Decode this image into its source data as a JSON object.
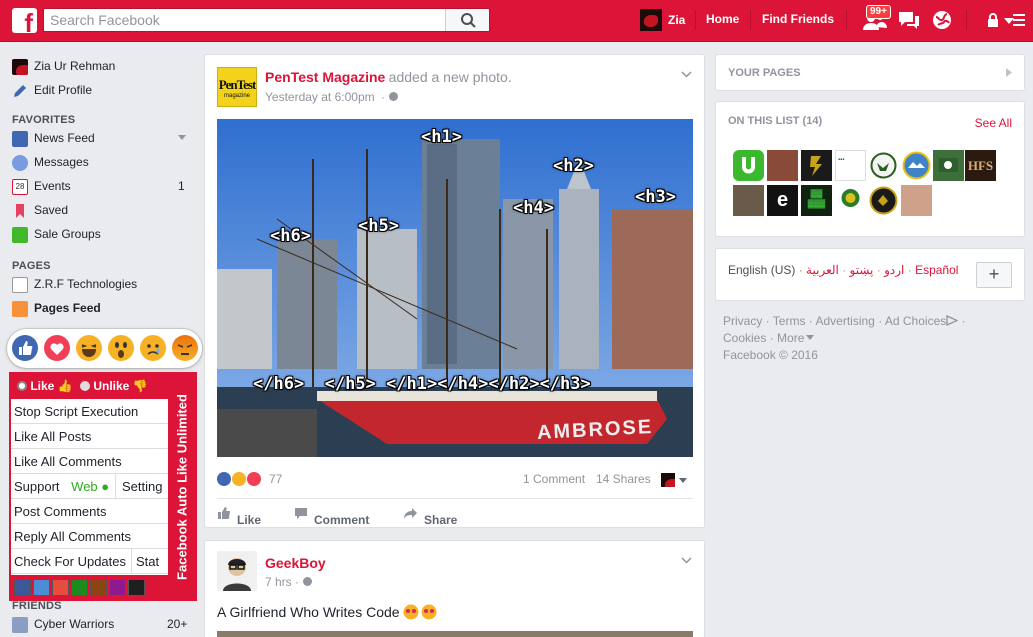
{
  "topbar": {
    "search_placeholder": "Search Facebook",
    "user_name": "Zia",
    "home_label": "Home",
    "find_friends_label": "Find Friends",
    "friend_requests_badge": "99+"
  },
  "left": {
    "profile_name": "Zia Ur Rehman",
    "edit_profile": "Edit Profile",
    "favorites_header": "FAVORITES",
    "favorites": [
      {
        "label": "News Feed",
        "count": ""
      },
      {
        "label": "Messages",
        "count": ""
      },
      {
        "label": "Events",
        "count": "1"
      },
      {
        "label": "Saved",
        "count": ""
      },
      {
        "label": "Sale Groups",
        "count": ""
      }
    ],
    "pages_header": "PAGES",
    "pages": [
      {
        "label": "Z.R.F Technologies"
      },
      {
        "label": "Pages Feed"
      }
    ],
    "friends_header": "FRIENDS",
    "friends": [
      {
        "label": "Cyber Warriors",
        "count": "20+"
      }
    ]
  },
  "script_panel": {
    "like_label": "Like",
    "unlike_label": "Unlike",
    "vertical_title": "Facebook Auto Like Unlimited",
    "rows": {
      "stop": "Stop Script Execution",
      "like_posts": "Like All Posts",
      "like_comments": "Like All Comments",
      "support": "Support",
      "web": "Web",
      "setting": "Setting",
      "post_comments": "Post Comments",
      "reply_comments": "Reply All Comments",
      "check_updates": "Check For Updates",
      "stat": "Stat"
    },
    "swatches": [
      "#3b5998",
      "#4a8fd6",
      "#e84c3d",
      "#1c8a1c",
      "#8b4513",
      "#8e1a8e",
      "#1f1f1f",
      "#dc1438"
    ]
  },
  "post1": {
    "page_name": "PenTest Magazine",
    "action": "added a new photo.",
    "time": "Yesterday at 6:00pm",
    "logo_text": "PenTest",
    "logo_sub": "magazine",
    "photo_tags_top": [
      "<h1>",
      "<h2>",
      "<h3>",
      "<h4>",
      "<h5>",
      "<h6>"
    ],
    "photo_tags_bottom": "</h6>  </h5> </h1></h4></h2></h3>",
    "ship_name": "AMBROSE",
    "reaction_count": "77",
    "comments": "1 Comment",
    "shares": "14 Shares",
    "like_action": "Like",
    "comment_action": "Comment",
    "share_action": "Share"
  },
  "post2": {
    "page_name": "GeekBoy",
    "time": "7 hrs",
    "text": "A Girlfriend Who Writes Code"
  },
  "right": {
    "your_pages": "YOUR PAGES",
    "on_this_list": "ON THIS LIST (14)",
    "see_all": "See All",
    "languages": {
      "current": "English (US)",
      "arabic": "العربية",
      "pashto": "پښتو",
      "urdu": "اردو",
      "spanish": "Español"
    },
    "footer_links": [
      "Privacy",
      "Terms",
      "Advertising",
      "Ad Choices",
      "Cookies",
      "More"
    ],
    "copyright": "Facebook © 2016"
  }
}
